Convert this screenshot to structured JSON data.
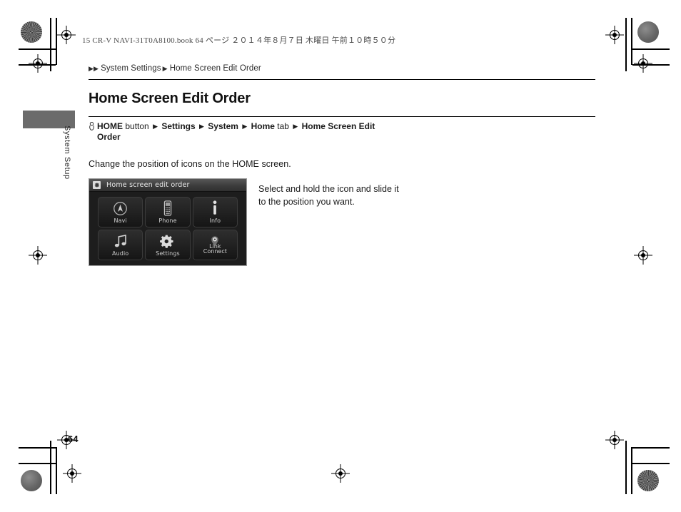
{
  "book_header": "15 CR-V NAVI-31T0A8100.book   64 ページ   ２０１４年８月７日   木曜日   午前１０時５０分",
  "side_tab": {
    "label": "System Setup"
  },
  "breadcrumb": {
    "arrow": "▶",
    "parent": "System Settings",
    "separator": "▶",
    "current": "Home Screen Edit Order"
  },
  "page_title": "Home Screen Edit Order",
  "nav_path": {
    "icon": "hand-press-icon",
    "triangle": "▶",
    "steps": [
      {
        "text": "HOME",
        "bold": true
      },
      {
        "text": "button",
        "bold": false
      },
      {
        "text": "Settings",
        "bold": true
      },
      {
        "text": "System",
        "bold": true
      },
      {
        "text": "Home",
        "bold": true
      },
      {
        "text": "tab",
        "bold": false
      },
      {
        "text": "Home Screen Edit Order",
        "bold": true
      }
    ]
  },
  "body_text": "Change the position of icons on the HOME screen.",
  "figure": {
    "screen_title": "Home screen edit order",
    "title_icon": "gear-icon",
    "tiles": [
      {
        "label": "Navi",
        "icon": "compass-icon"
      },
      {
        "label": "Phone",
        "icon": "phone-handset-icon"
      },
      {
        "label": "Info",
        "icon": "info-icon"
      },
      {
        "label": "Audio",
        "icon": "music-note-icon"
      },
      {
        "label": "Settings",
        "icon": "gear-icon"
      },
      {
        "label": "Link",
        "sublabel": "Connect",
        "icon": "map-pin-icon"
      }
    ]
  },
  "figure_caption": "Select and hold the icon and slide it to the position you want.",
  "page_number": "64",
  "colors": {
    "side_tab": "#6b6b6b",
    "screen_bg": "#1d1d1d",
    "screen_titlebar": "#3c3c3c",
    "tile_text": "#cfcfcf"
  }
}
